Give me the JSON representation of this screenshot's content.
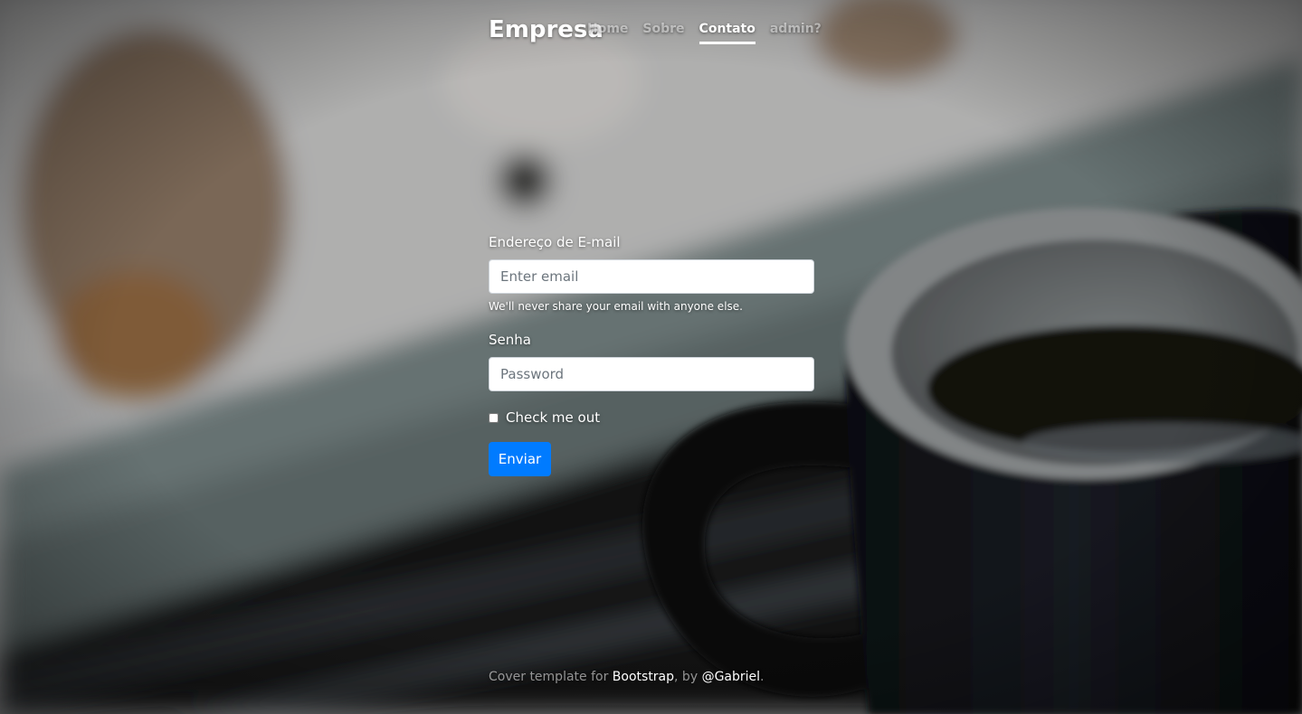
{
  "header": {
    "brand": "Empresa",
    "nav": [
      {
        "label": "Home",
        "active": false
      },
      {
        "label": "Sobre",
        "active": false
      },
      {
        "label": "Contato",
        "active": true
      },
      {
        "label": "admin?",
        "active": false
      }
    ]
  },
  "form": {
    "email_label": "Endereço de E-mail",
    "email_placeholder": "Enter email",
    "email_help": "We'll never share your email with anyone else.",
    "password_label": "Senha",
    "password_placeholder": "Password",
    "check_label": "Check me out",
    "submit_label": "Enviar"
  },
  "footer": {
    "prefix": "Cover template for ",
    "link1": "Bootstrap",
    "middle": ", by ",
    "link2": "@Gabriel",
    "suffix": "."
  },
  "colors": {
    "accent": "#007bff",
    "text": "#ffffff"
  }
}
